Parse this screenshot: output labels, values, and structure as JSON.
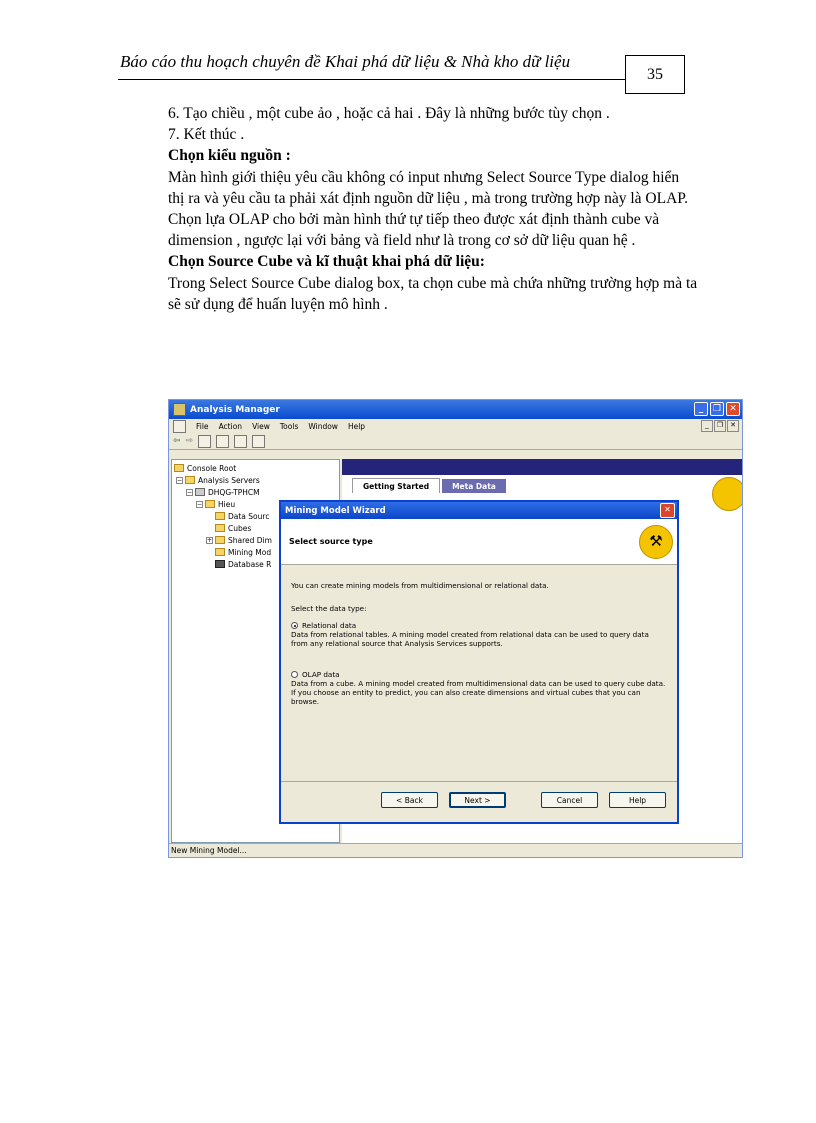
{
  "header": {
    "title": "Báo cáo thu hoạch chuyên đề Khai phá dữ liệu & Nhà kho dữ liệu",
    "page_number": "35"
  },
  "body": {
    "lines": [
      {
        "text": "6. Tạo  chiều , một cube ảo , hoặc cả hai . Đây là những bước tùy chọn  .",
        "bold": false
      },
      {
        "text": "7. Kết thúc .",
        "bold": false
      },
      {
        "text": "Chọn kiểu nguồn :",
        "bold": true
      },
      {
        "text": "Màn hình giới thiệu yêu cầu không có input nhưng  Select Source Type dialog hiển thị ra và  yêu cầu ta phải xát định nguồn  dữ liệu , mà trong trường hợp này là OLAP.",
        "bold": false
      },
      {
        "text": "Chọn lựa OLAP  cho bởi màn hình thứ tự tiếp theo được xát định thành cube và  dimension , ngược lại với bảng và field như là trong cơ sở dữ liệu quan hệ .",
        "bold": false
      },
      {
        "text": "Chọn Source Cube và kĩ thuật khai phá  dữ liệu:",
        "bold": true
      },
      {
        "text": "Trong  Select Source Cube dialog box, ta chọn cube mà chứa những  trường hợp mà ta sẽ sử dụng để huấn  luyện mô hình .",
        "bold": false
      }
    ]
  },
  "screenshot": {
    "window_title": "Analysis Manager",
    "menu": [
      "File",
      "Action",
      "View",
      "Tools",
      "Window",
      "Help"
    ],
    "tree": [
      {
        "label": "Console Root",
        "indent": 0
      },
      {
        "label": "Analysis Servers",
        "indent": 1
      },
      {
        "label": "DHQG-TPHCM",
        "indent": 2
      },
      {
        "label": "Hieu",
        "indent": 3
      },
      {
        "label": "Data Sourc",
        "indent": 4
      },
      {
        "label": "Cubes",
        "indent": 4
      },
      {
        "label": "Shared Dim",
        "indent": 4
      },
      {
        "label": "Mining Mod",
        "indent": 4
      },
      {
        "label": "Database R",
        "indent": 4
      }
    ],
    "tabs": [
      "Getting Started",
      "Meta Data"
    ],
    "status": "New Mining Model...",
    "dialog": {
      "title": "Mining Model Wizard",
      "heading": "Select source type",
      "intro": "You can create mining models from multidimensional or relational data.",
      "prompt": "Select the data type:",
      "option1_label": "Relational data",
      "option1_desc": "Data from relational tables. A mining model created from relational data can be used to query data from any relational source that Analysis Services supports.",
      "option2_label": "OLAP data",
      "option2_desc": "Data from a cube. A mining model created from multidimensional data can be used to query cube data. If you choose an entity to predict, you can also create dimensions and virtual cubes that you can browse.",
      "buttons": {
        "back": "< Back",
        "next": "Next >",
        "cancel": "Cancel",
        "help": "Help"
      }
    }
  }
}
